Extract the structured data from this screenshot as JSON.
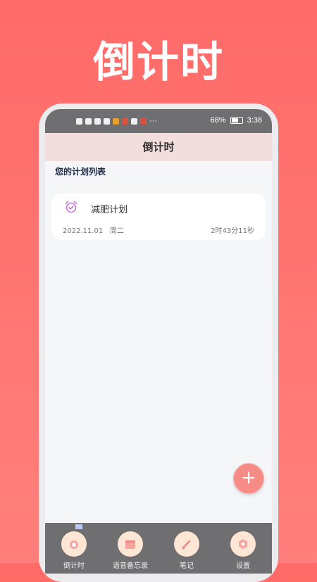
{
  "promo_title": "倒计时",
  "statusbar": {
    "battery_percent": "68%",
    "battery_level": 0.68,
    "time": "3:38",
    "more": "···"
  },
  "app": {
    "title": "倒计时",
    "section_title": "您的计划列表"
  },
  "plans": [
    {
      "name": "减肥计划",
      "date": "2022.11.01",
      "weekday": "周二",
      "remaining": "2时43分11秒",
      "icon": "alarm-clock-icon"
    }
  ],
  "fab": {
    "label": "+"
  },
  "tabs": [
    {
      "label": "倒计时",
      "icon": "alarm-clock-icon",
      "active": true
    },
    {
      "label": "语音备忘录",
      "icon": "calendar-icon",
      "active": false
    },
    {
      "label": "笔记",
      "icon": "pen-icon",
      "active": false
    },
    {
      "label": "设置",
      "icon": "settings-icon",
      "active": false
    }
  ],
  "colors": {
    "background": "#ff6b68",
    "appbar": "#f3dede",
    "fab": "#f78c87",
    "accent_icon": "#c679e0",
    "tab_circle": "#fde7d4"
  }
}
